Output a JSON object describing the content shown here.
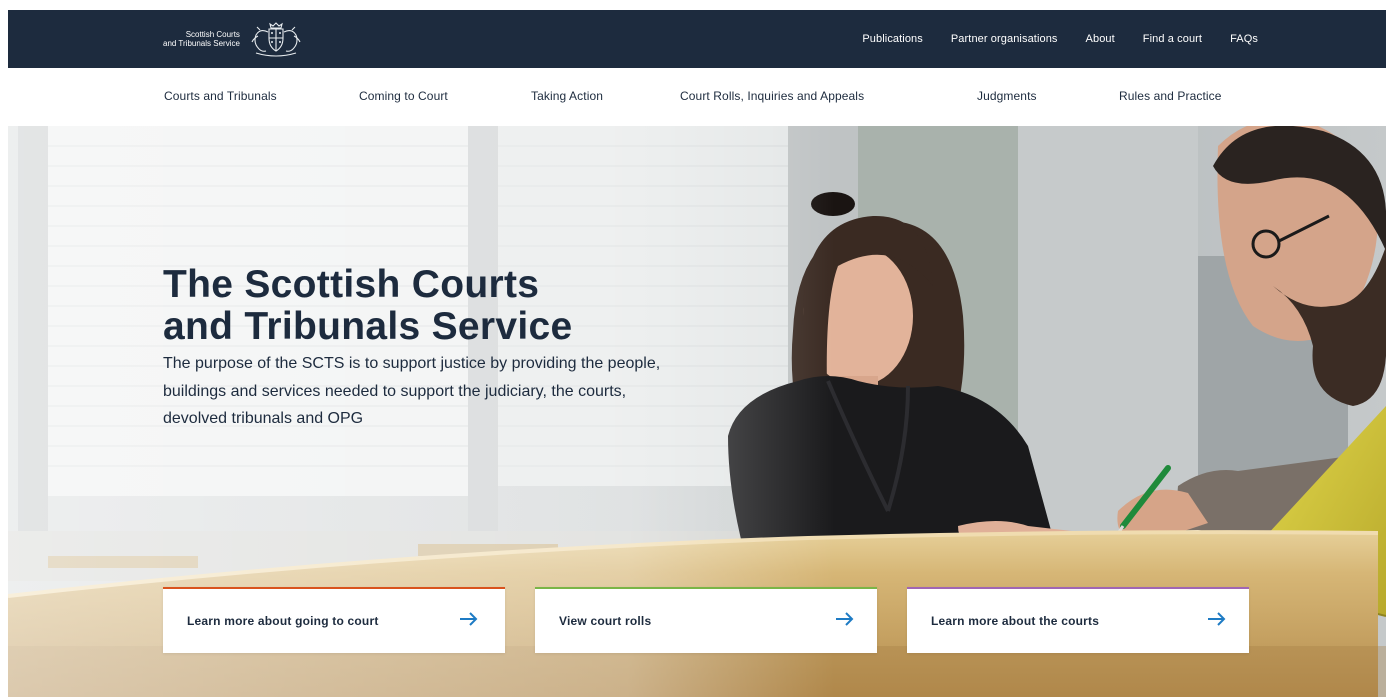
{
  "brand": {
    "line1": "Scottish Courts",
    "line2": "and Tribunals Service"
  },
  "utility_nav": [
    "Publications",
    "Partner organisations",
    "About",
    "Find a court",
    "FAQs"
  ],
  "main_nav": [
    "Courts and Tribunals",
    "Coming to Court",
    "Taking Action",
    "Court Rolls, Inquiries and Appeals",
    "Judgments",
    "Rules and Practice"
  ],
  "hero": {
    "title_line1": "The Scottish Courts",
    "title_line2": "and Tribunals Service",
    "description": "The purpose of the SCTS is to support justice by providing the people, buildings and services needed to support the judiciary, the courts, devolved tribunals and OPG"
  },
  "ctas": [
    {
      "label": "Learn more about going to court",
      "accent": "#d9531e"
    },
    {
      "label": "View court rolls",
      "accent": "#7ab547"
    },
    {
      "label": "Learn more about the courts",
      "accent": "#a066b4"
    }
  ],
  "icons": {
    "crest": "royal-crest-icon",
    "arrow": "arrow-right-icon"
  },
  "colors": {
    "navy": "#1d2b3e",
    "arrow": "#1e7bc4"
  }
}
